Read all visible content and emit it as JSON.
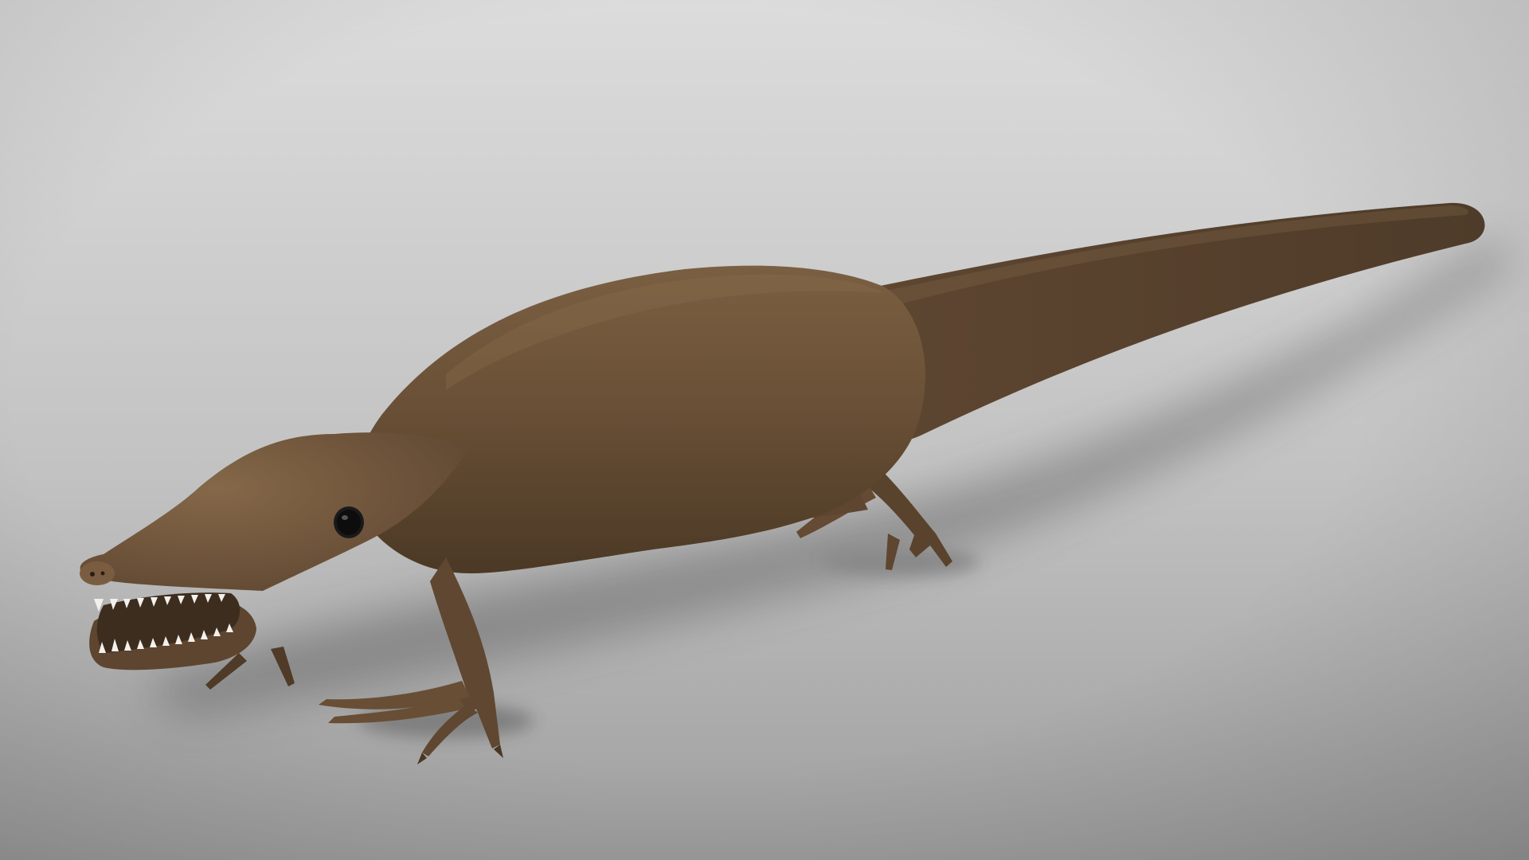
{
  "scene": {
    "subject": "creature-render",
    "colors": {
      "backdrop_light": "#d9d9d9",
      "backdrop_dark": "#9c9c9c",
      "body": "#6b5237",
      "body_shade": "#4a3824",
      "body_highlight": "#8a6c4c",
      "mouth": "#3d2d1f",
      "teeth": "#f4f2ee",
      "eye": "#141414"
    },
    "icons": [
      "creature-body",
      "tail",
      "head",
      "eye",
      "teeth",
      "front-leg",
      "hind-leg"
    ]
  }
}
